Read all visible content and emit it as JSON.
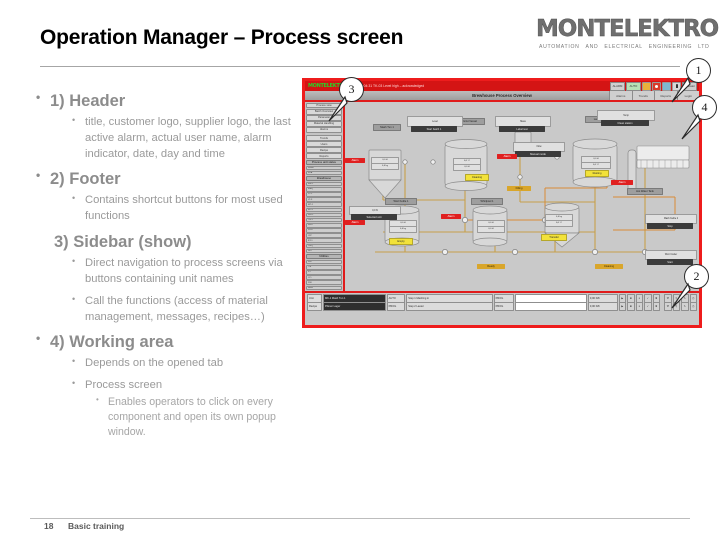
{
  "slide": {
    "title": "Operation Manager – Process screen",
    "footer_number": "18",
    "footer_text": "Basic training"
  },
  "logo": {
    "word": "MONTELEKTRO",
    "sub1": "AUTOMATION",
    "sub2": "AND",
    "sub3": "ELECTRICAL",
    "sub4": "ENGINEERING",
    "sub5": "LTD"
  },
  "bullets": [
    {
      "level": 1,
      "text": "1) Header"
    },
    {
      "level": 2,
      "text": "title, customer logo, supplier logo, the last active alarm, actual user name, alarm indicator, date, day and time"
    },
    {
      "level": 1,
      "text": "2) Footer"
    },
    {
      "level": 2,
      "text": "Contains shortcut buttons for most used functions"
    },
    {
      "level": 1,
      "text": "3) Sidebar (show)",
      "nodot": true
    },
    {
      "level": 2,
      "text": "Direct navigation to process screens via buttons containing unit names"
    },
    {
      "level": 2,
      "text": "Call the functions  (access of material management, messages, recipes…)"
    },
    {
      "level": 1,
      "text": "4) Working area"
    },
    {
      "level": 2,
      "text": "Depends on the opened tab"
    },
    {
      "level": 2,
      "text": "Process screen"
    },
    {
      "level": 3,
      "text": "Enables operators to click on every component and open its own popup window."
    }
  ],
  "callouts": [
    {
      "id": "1",
      "label": "1"
    },
    {
      "id": "2",
      "label": "2"
    },
    {
      "id": "3",
      "label": "3"
    },
    {
      "id": "4",
      "label": "4"
    }
  ],
  "scada": {
    "brand": "MONTELEKTRO",
    "alarm_ticker": "12:04:31  TK-03 Level high  –  acknowledged",
    "screen_title": "Brewhouse Process Overview",
    "header_buttons": [
      {
        "name": "alarm-button",
        "label": "ALARM"
      },
      {
        "name": "status-button",
        "label": "AUTO"
      }
    ],
    "header_icons": [
      {
        "name": "warning-icon",
        "glyph": "!"
      },
      {
        "name": "power-icon",
        "glyph": "⏻"
      },
      {
        "name": "help-icon",
        "glyph": "?"
      },
      {
        "name": "user-icon",
        "glyph": "♟"
      }
    ],
    "header_user": "Operator",
    "title_tabs": [
      {
        "name": "tab-alarms",
        "label": "Alarms"
      },
      {
        "name": "tab-trends",
        "label": "Trends"
      },
      {
        "name": "tab-reports",
        "label": "Reports"
      },
      {
        "name": "tab-login",
        "label": "Login"
      }
    ],
    "sidebar": {
      "nav_buttons": [
        "Process view",
        "Batch Overview",
        "Parameter",
        "Material Handling",
        "Alarms",
        "Trends",
        "Users",
        "Recipe",
        "Reports"
      ],
      "section_status": "Process unit status",
      "status_rows": [
        {
          "name": "WMH",
          "value": ""
        },
        {
          "name": "FKA",
          "value": ""
        }
      ],
      "section_brewhouse": "Brewhouse",
      "unit_rows": [
        "MK-1",
        "MBQ",
        "LT-2",
        "LT-3",
        "MT-1",
        "MT-2",
        "WK-1",
        "TB-1",
        "WRT",
        "ZKG",
        "CIP",
        "BT-1",
        "CRQ",
        "SKT"
      ],
      "section_utility": "Utilities",
      "utility_rows": [
        "SW",
        "TM",
        "ST",
        "CO",
        "DW",
        "RMS"
      ]
    },
    "work_area": {
      "unit_labels": [
        "Mash Tun 1",
        "Grist Vessel",
        "Lauter Tun 1",
        "Wort Kettle 1",
        "Whirlpool 1",
        "Hot Water Tank",
        "Cold Water Tank",
        "Hop Dosing",
        "Mash Kettle 2",
        "Mill",
        "Wort Cooler",
        "Yeast Dosing"
      ],
      "popup_buttons": [
        "Start batch 1",
        "Label test",
        "Clean station",
        "Manual mode",
        "Selected unit",
        "Stop",
        "Start",
        "Open",
        "Close"
      ],
      "value_fields": [
        {
          "label": "Level",
          "value": "0,0 hl"
        },
        {
          "label": "Mass",
          "value": "0,0 kg"
        },
        {
          "label": "Temp",
          "value": "0,0 °C"
        },
        {
          "label": "Flow",
          "value": "0,0 hl"
        }
      ],
      "state_tags": [
        "Cleaning",
        "Filling",
        "Resting",
        "Transfer",
        "Empty",
        "Ready"
      ],
      "alarm_tags": [
        "Alarm"
      ]
    },
    "footer": {
      "rows": [
        {
          "unit": "Unit",
          "unit_value": "MK-1 Mash Tun 1",
          "mode": "AUTO",
          "step": "Step 1  Mashing in",
          "prog": "PROG",
          "prog_value": "",
          "rate": "0,00 hl/h",
          "buttons": [
            "▶",
            "■",
            "⏸",
            "✓",
            "✖"
          ]
        },
        {
          "unit": "Recipe",
          "unit_value": "Pilsner Lager",
          "mode": "PROG",
          "step": "Step 2  Lauter",
          "prog": "PROG",
          "prog_value": "",
          "rate": "0,00 hl/h",
          "buttons": [
            "▶",
            "■",
            "⏸",
            "✓",
            "✖"
          ]
        }
      ],
      "shortcut_icons": [
        "wrench-icon",
        "key-icon",
        "pen-icon",
        "print-icon"
      ]
    }
  },
  "colors": {
    "accent_red": "#ee1c1c",
    "text_gray": "#8c8c8c",
    "title_black": "#000000",
    "scada_bg": "#c9c9c9"
  }
}
